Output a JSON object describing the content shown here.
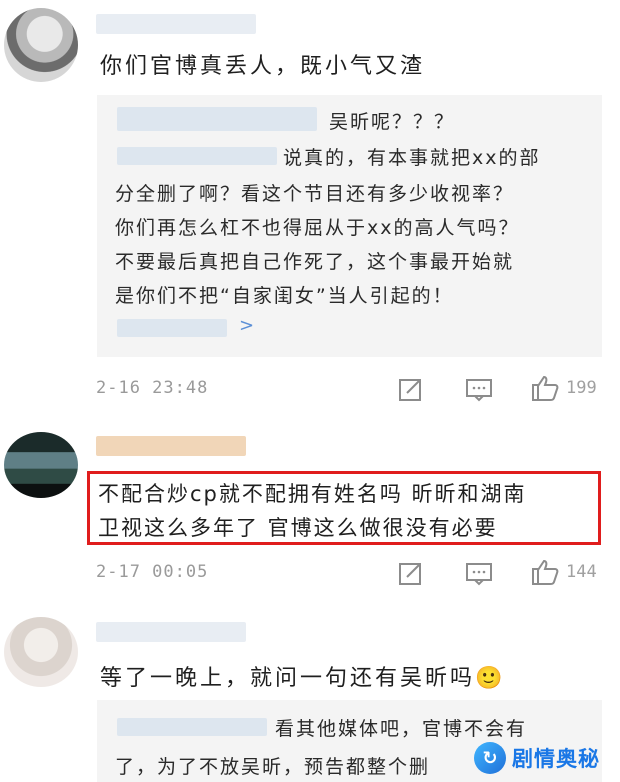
{
  "comments": [
    {
      "text": "你们官博真丢人，既小气又渣",
      "quote": {
        "lines": [
          "吴昕呢？？？",
          "说真的，有本事就把xx的部",
          "分全删了啊？看这个节目还有多少收视率？",
          "你们再怎么杠不也得屈从于xx的高人气吗？",
          "不要最后真把自己作死了，这个事最开始就",
          "是你们不把“自家闺女”当人引起的！"
        ],
        "more_chevron": ">"
      },
      "time": "2-16 23:48",
      "like_count": "199"
    },
    {
      "text_line1": "不配合炒cp就不配拥有姓名吗 昕昕和湖南",
      "text_line2": "卫视这么多年了 官博这么做很没有必要",
      "time": "2-17 00:05",
      "like_count": "144"
    },
    {
      "text": "等了一晚上，就问一句还有吴昕吗",
      "emoji": "🙂",
      "quote": {
        "lines": [
          "看其他媒体吧，官博不会有",
          "了，为了不放吴昕，预告都整个删"
        ]
      }
    }
  ],
  "icons": {
    "edit": "edit-icon",
    "reply": "comment-icon",
    "like": "thumbs-up-icon"
  },
  "colors": {
    "highlight": "#e01d1d",
    "link": "#5b8fd6",
    "watermark": "#1a77e6"
  },
  "watermark": {
    "text": "剧情奥秘"
  }
}
